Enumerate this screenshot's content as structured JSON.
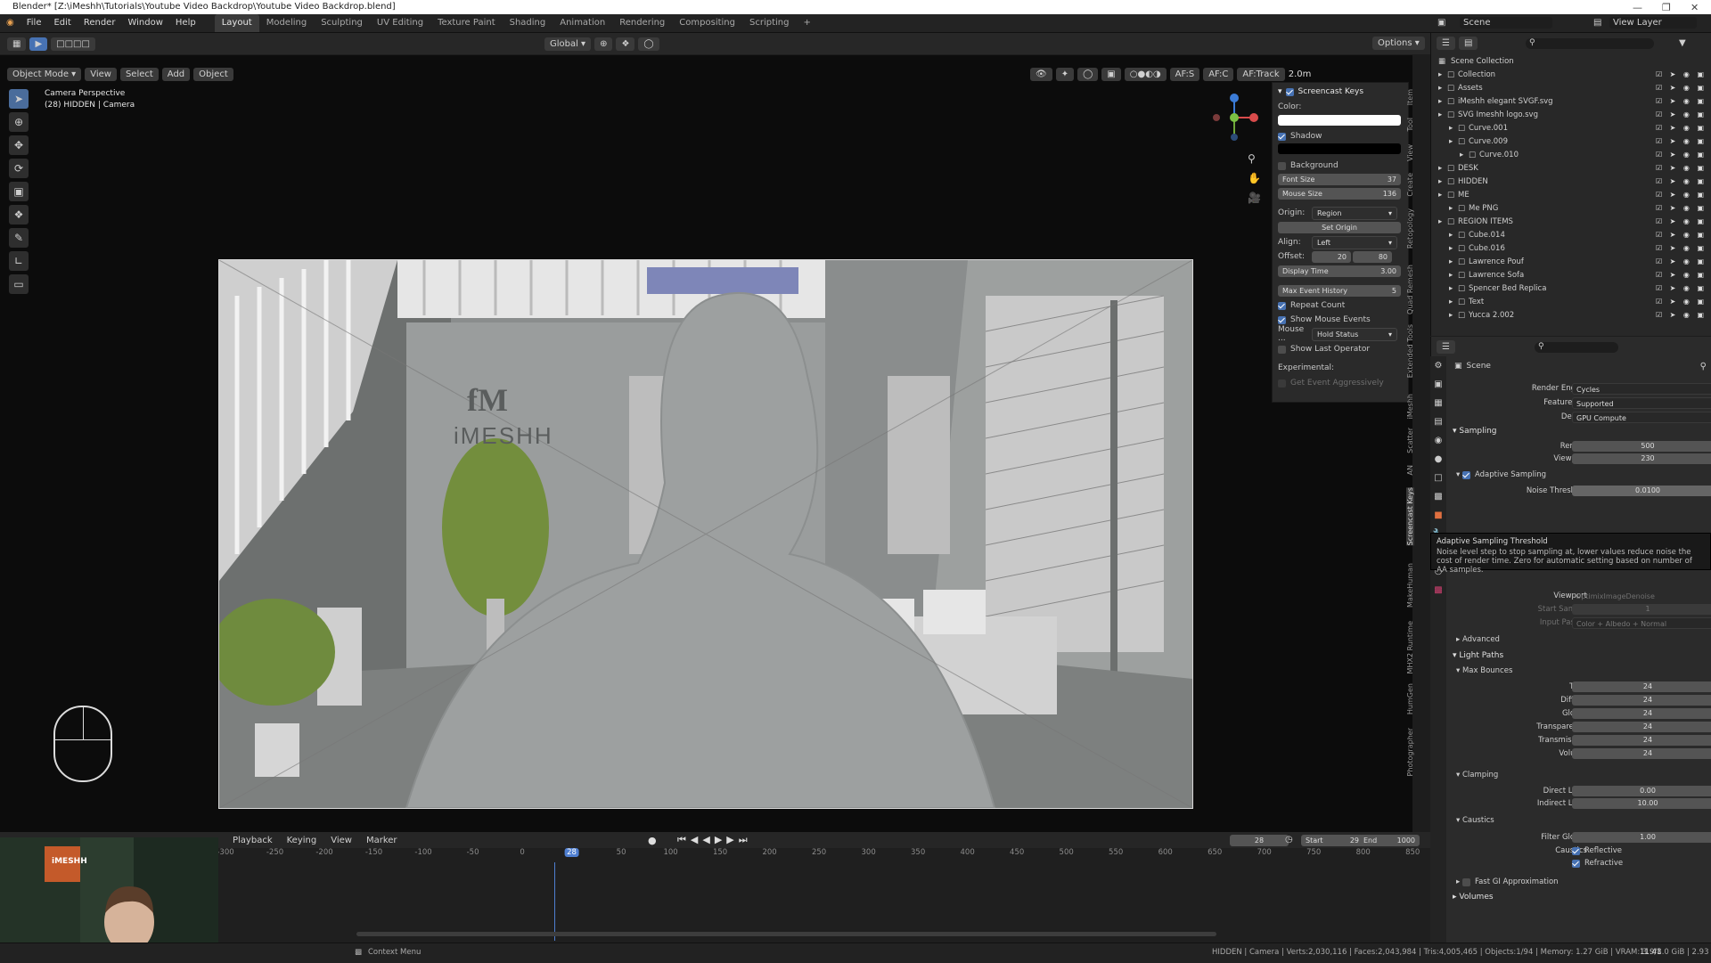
{
  "titlebar": {
    "title": "Blender* [Z:\\iMeshh\\Tutorials\\Youtube Video Backdrop\\Youtube Video Backdrop.blend]"
  },
  "menubar": {
    "menus": [
      "File",
      "Edit",
      "Render",
      "Window",
      "Help"
    ],
    "workspaces": [
      "Layout",
      "Modeling",
      "Sculpting",
      "UV Editing",
      "Texture Paint",
      "Shading",
      "Animation",
      "Rendering",
      "Compositing",
      "Scripting"
    ],
    "active_workspace": "Layout",
    "add_tab": "+",
    "scene_label": "Scene",
    "view_layer_label": "View Layer"
  },
  "toolheader": {
    "orientation": "Global",
    "options": "Options"
  },
  "viewport_header": {
    "mode": "Object Mode",
    "menus": [
      "View",
      "Select",
      "Add",
      "Object"
    ],
    "af_s": "AF:S",
    "af_c": "AF:C",
    "af_track": "AF:Track",
    "distance": "2.0m"
  },
  "viewport": {
    "camera_label": "Camera Perspective",
    "camera_sub": "(28) HIDDEN | Camera",
    "logo_top": "fM",
    "logo_text": "iMESHH"
  },
  "keys_panel": {
    "title": "Screencast Keys",
    "color_label": "Color:",
    "shadow": "Shadow",
    "background": "Background",
    "font_size_label": "Font Size",
    "font_size": "37",
    "mouse_size_label": "Mouse Size",
    "mouse_size": "136",
    "origin_label": "Origin:",
    "origin_value": "Region",
    "set_origin": "Set Origin",
    "align_label": "Align:",
    "align_value": "Left",
    "offset_label": "Offset:",
    "offset_x": "20",
    "offset_y": "80",
    "display_time_label": "Display Time",
    "display_time": "3.00",
    "max_event_label": "Max Event History",
    "max_event": "5",
    "repeat_count": "Repeat Count",
    "show_mouse_events": "Show Mouse Events",
    "mouse_label": "Mouse ...",
    "mouse_value": "Hold Status",
    "show_last_operator": "Show Last Operator",
    "experimental": "Experimental:",
    "get_event": "Get Event Aggressively"
  },
  "side_tabs": [
    "Item",
    "Tool",
    "View",
    "Create",
    "Retopology",
    "Quad Remesh",
    "Extended Tools",
    "iMeshh",
    "Scatter",
    "AN",
    "Screencast Keys",
    "MakeHuman",
    "MHX2 Runtime",
    "HumGen",
    "Photographer"
  ],
  "outliner": {
    "root": "Scene Collection",
    "items": [
      {
        "name": "Collection",
        "indent": 1
      },
      {
        "name": "Assets",
        "indent": 1
      },
      {
        "name": "iMeshh elegant SVGF.svg",
        "indent": 1
      },
      {
        "name": "SVG Imeshh logo.svg",
        "indent": 1
      },
      {
        "name": "Curve.001",
        "indent": 2
      },
      {
        "name": "Curve.009",
        "indent": 2
      },
      {
        "name": "Curve.010",
        "indent": 3
      },
      {
        "name": "DESK",
        "indent": 1
      },
      {
        "name": "HIDDEN",
        "indent": 1
      },
      {
        "name": "ME",
        "indent": 1
      },
      {
        "name": "Me PNG",
        "indent": 2
      },
      {
        "name": "REGION ITEMS",
        "indent": 1
      },
      {
        "name": "Cube.014",
        "indent": 2
      },
      {
        "name": "Cube.016",
        "indent": 2
      },
      {
        "name": "Lawrence Pouf",
        "indent": 2
      },
      {
        "name": "Lawrence Sofa",
        "indent": 2
      },
      {
        "name": "Spencer Bed Replica",
        "indent": 2
      },
      {
        "name": "Text",
        "indent": 2
      },
      {
        "name": "Yucca 2.002",
        "indent": 2
      }
    ]
  },
  "properties": {
    "breadcrumb": "Scene",
    "render_engine_label": "Render Engine",
    "render_engine": "Cycles",
    "feature_set_label": "Feature Set",
    "feature_set": "Supported",
    "device_label": "Device",
    "device": "GPU Compute",
    "sampling": "Sampling",
    "render_label": "Render",
    "render_samples": "500",
    "viewport_label": "Viewport",
    "viewport_samples": "230",
    "adaptive_sampling": "Adaptive Sampling",
    "noise_threshold_label": "Noise Threshold",
    "noise_threshold": "0.0100",
    "tooltip_title": "Adaptive Sampling Threshold",
    "tooltip_body": "Noise level step to stop sampling at, lower values reduce noise the cost of render time. Zero for automatic setting based on number of AA samples.",
    "denoise_viewport_label": "Viewport",
    "denoise_viewport": "OptimixImageDenoise",
    "start_sample_label": "Start Sample",
    "start_sample": "1",
    "input_passes_label": "Input Passes",
    "input_passes": "Color + Albedo + Normal",
    "advanced": "Advanced",
    "light_paths": "Light Paths",
    "max_bounces": "Max Bounces",
    "bounces": [
      {
        "label": "Total",
        "value": "24"
      },
      {
        "label": "Diffuse",
        "value": "24"
      },
      {
        "label": "Glossy",
        "value": "24"
      },
      {
        "label": "Transparency",
        "value": "24"
      },
      {
        "label": "Transmission",
        "value": "24"
      },
      {
        "label": "Volume",
        "value": "24"
      }
    ],
    "clamping": "Clamping",
    "direct_light_label": "Direct Light",
    "direct_light": "0.00",
    "indirect_light_label": "Indirect Light",
    "indirect_light": "10.00",
    "caustics": "Caustics",
    "filter_glossy_label": "Filter Glossy",
    "filter_glossy": "1.00",
    "caustics_label": "Caustics",
    "reflective": "Reflective",
    "refractive": "Refractive",
    "fast_gi": "Fast GI Approximation",
    "volumes": "Volumes"
  },
  "timeline": {
    "menus": [
      "Playback",
      "Keying",
      "View",
      "Marker"
    ],
    "current_frame": "28",
    "start_label": "Start",
    "start": "29",
    "end_label": "End",
    "end": "1000",
    "ticks": [
      "-300",
      "-250",
      "-200",
      "-150",
      "-100",
      "-50",
      "0",
      "28",
      "50",
      "100",
      "150",
      "200",
      "250",
      "300",
      "350",
      "400",
      "450",
      "500",
      "550",
      "600",
      "650",
      "700",
      "750",
      "800",
      "850"
    ]
  },
  "statusbar": {
    "context_menu": "Context Menu",
    "stats": "HIDDEN | Camera | Verts:2,030,116 | Faces:2,043,984 | Tris:4,005,465 | Objects:1/94 | Memory: 1.27 GiB | VRAM: 3.9/8.0 GiB | 2.93",
    "clock": "11:41"
  },
  "webcam": {
    "logo": "iMESHH"
  },
  "colors": {
    "accent": "#4772b3",
    "playhead": "#4f7fd1",
    "background": "#1d1d1d"
  }
}
